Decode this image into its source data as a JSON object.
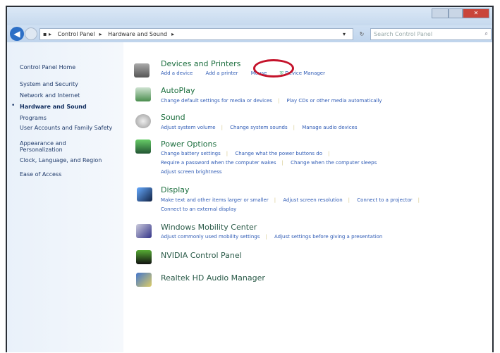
{
  "window": {
    "controls": [
      "minimize",
      "maximize",
      "close"
    ]
  },
  "address": {
    "crumbs": [
      "Control Panel",
      "Hardware and Sound"
    ],
    "search_placeholder": "Search Control Panel"
  },
  "sidebar": {
    "items": [
      "Control Panel Home",
      "System and Security",
      "Network and Internet",
      "Hardware and Sound",
      "Programs",
      "User Accounts and Family Safety",
      "Appearance and Personalization",
      "Clock, Language, and Region",
      "Ease of Access"
    ]
  },
  "sections": [
    {
      "title": "Devices and Printers",
      "links": [
        "Add a device",
        "Add a printer",
        "Mouse",
        "Device Manager"
      ]
    },
    {
      "title": "AutoPlay",
      "links": [
        "Change default settings for media or devices",
        "Play CDs or other media automatically"
      ]
    },
    {
      "title": "Sound",
      "links": [
        "Adjust system volume",
        "Change system sounds",
        "Manage audio devices"
      ]
    },
    {
      "title": "Power Options",
      "links": [
        "Change battery settings",
        "Change what the power buttons do",
        "Require a password when the computer wakes",
        "Change when the computer sleeps",
        "Adjust screen brightness"
      ]
    },
    {
      "title": "Display",
      "links": [
        "Make text and other items larger or smaller",
        "Adjust screen resolution",
        "Connect to a projector",
        "Connect to an external display"
      ]
    },
    {
      "title": "Windows Mobility Center",
      "links": [
        "Adjust commonly used mobility settings",
        "Adjust settings before giving a presentation"
      ]
    },
    {
      "title": "NVIDIA Control Panel",
      "links": []
    },
    {
      "title": "Realtek HD Audio Manager",
      "links": []
    }
  ],
  "highlight": "Mouse"
}
